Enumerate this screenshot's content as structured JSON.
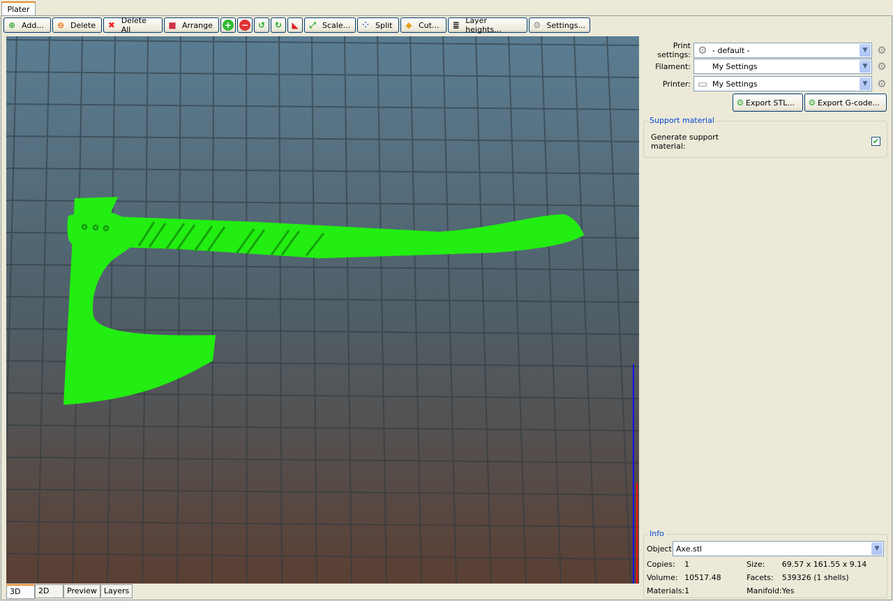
{
  "tabs": {
    "plater": "Plater"
  },
  "toolbar": {
    "add": "Add...",
    "delete": "Delete",
    "delete_all": "Delete All",
    "arrange": "Arrange",
    "scale": "Scale...",
    "split": "Split",
    "cut": "Cut...",
    "layer_heights": "Layer heights...",
    "settings": "Settings..."
  },
  "view_tabs": [
    "3D",
    "2D",
    "Preview",
    "Layers"
  ],
  "presets": {
    "print_label": "Print settings:",
    "print_value": "- default -",
    "filament_label": "Filament:",
    "filament_value": "My Settings",
    "printer_label": "Printer:",
    "printer_value": "My Settings"
  },
  "export": {
    "stl": "Export STL...",
    "gcode": "Export G-code..."
  },
  "support": {
    "title": "Support material",
    "generate_label": "Generate support material:",
    "generate_checked": true
  },
  "info": {
    "title": "Info",
    "object_label": "Object:",
    "object_value": "Axe.stl",
    "copies_label": "Copies:",
    "copies": "1",
    "volume_label": "Volume:",
    "volume": "10517.48",
    "materials_label": "Materials:",
    "materials": "1",
    "size_label": "Size:",
    "size": "69.57 x 161.55 x 9.14",
    "facets_label": "Facets:",
    "facets": "539326 (1 shells)",
    "manifold_label": "Manifold:",
    "manifold": "Yes"
  },
  "colors": {
    "model": "#22ee11",
    "accent": "#0046d5"
  }
}
